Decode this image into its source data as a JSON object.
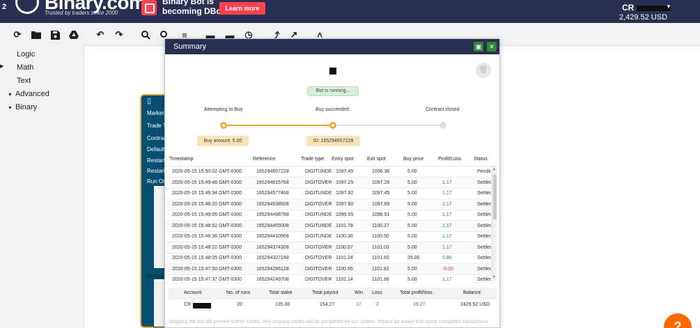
{
  "header": {
    "logo_text": "Binary.com",
    "tagline": "Trusted by traders since 2000",
    "promo_line1": "Binary Bot is",
    "promo_line2": "becoming DBot",
    "learn_more": "Learn more",
    "account_prefix": "CR",
    "balance": "2,429.52 USD"
  },
  "toolbar": {
    "icons": [
      "reset-icon",
      "open-folder-icon",
      "save-icon",
      "google-drive-icon",
      "undo-icon",
      "redo-icon",
      "zoom-in-icon",
      "zoom-out-icon",
      "rearrange-icon",
      "chart-icon",
      "tradingview-icon",
      "clock-icon",
      "run-icon",
      "stop-icon",
      "arrow-icon"
    ]
  },
  "sidebar": {
    "items": [
      {
        "label": "Logic",
        "caret": ""
      },
      {
        "label": "Math",
        "caret": ""
      },
      {
        "label": "Text",
        "caret": ""
      },
      {
        "label": "Advanced",
        "caret": "▼"
      },
      {
        "label": "Binary",
        "caret": "▼"
      }
    ]
  },
  "blocks": {
    "labels": [
      "Market",
      "Trade T",
      "Contrac",
      "Default",
      "Restart",
      "Restart",
      "Run On"
    ],
    "define_label": "Define"
  },
  "modal": {
    "title": "Summary",
    "status": "Bot is running...",
    "steps": [
      "Attempting to Buy",
      "Buy succeeded",
      "Contract closed"
    ],
    "buy_amount": "Buy amount: 5.00",
    "contract_id": "ID: 165294657228",
    "columns": [
      "Timestamp",
      "Reference",
      "Trade type",
      "Entry spot",
      "Exit spot",
      "Buy price",
      "Profit/Loss",
      "Status"
    ],
    "rows": [
      {
        "timestamp": "2020-05-15 15:50:02 GMT-0300",
        "reference": "165294657228",
        "type": "DIGITUNDE",
        "entry": "1097.45",
        "exit": "1096.36",
        "buy": "5.00",
        "pl": "",
        "pl_class": "",
        "status": "Pendin"
      },
      {
        "timestamp": "2020-05-15 15:49:48 GMT-0300",
        "reference": "165294615768",
        "type": "DIGITOVER",
        "entry": "1097.25",
        "exit": "1097.26",
        "buy": "5.00",
        "pl": "1.17",
        "pl_class": "pos",
        "status": "Settlec"
      },
      {
        "timestamp": "2020-05-15 15:49:34 GMT-0300",
        "reference": "165294577468",
        "type": "DIGITUNDE",
        "entry": "1097.92",
        "exit": "1097.45",
        "buy": "5.00",
        "pl": "1.17",
        "pl_class": "pos",
        "status": "Settlec"
      },
      {
        "timestamp": "2020-05-15 15:49:20 GMT-0300",
        "reference": "165294538508",
        "type": "DIGITOVER",
        "entry": "1097.60",
        "exit": "1097.69",
        "buy": "5.00",
        "pl": "1.17",
        "pl_class": "pos",
        "status": "Settlec"
      },
      {
        "timestamp": "2020-05-15 15:49:06 GMT-0300",
        "reference": "165294498788",
        "type": "DIGITUNDE",
        "entry": "1099.55",
        "exit": "1098.91",
        "buy": "5.00",
        "pl": "1.17",
        "pl_class": "pos",
        "status": "Settlec"
      },
      {
        "timestamp": "2020-05-15 15:48:52 GMT-0300",
        "reference": "165294455008",
        "type": "DIGITUNDE",
        "entry": "1101.78",
        "exit": "1100.27",
        "buy": "5.00",
        "pl": "1.17",
        "pl_class": "pos",
        "status": "Settlec"
      },
      {
        "timestamp": "2020-05-15 15:48:36 GMT-0300",
        "reference": "165294410908",
        "type": "DIGITUNDE",
        "entry": "1100.30",
        "exit": "1100.50",
        "buy": "5.00",
        "pl": "1.17",
        "pl_class": "pos",
        "status": "Settlec"
      },
      {
        "timestamp": "2020-05-15 15:48:22 GMT-0300",
        "reference": "165294374308",
        "type": "DIGITOVER",
        "entry": "1100.67",
        "exit": "1101.03",
        "buy": "5.00",
        "pl": "1.17",
        "pl_class": "pos",
        "status": "Settlec"
      },
      {
        "timestamp": "2020-05-15 15:48:05 GMT-0300",
        "reference": "165294327248",
        "type": "DIGITOVER",
        "entry": "1101.24",
        "exit": "1101.60",
        "buy": "25.00",
        "pl": "5.86",
        "pl_class": "pos",
        "status": "Settlec"
      },
      {
        "timestamp": "2020-05-15 15:47:50 GMT-0300",
        "reference": "165294286128",
        "type": "DIGITOVER",
        "entry": "1100.66",
        "exit": "1101.81",
        "buy": "5.00",
        "pl": "-5.00",
        "pl_class": "neg",
        "status": "Settlec"
      },
      {
        "timestamp": "2020-05-15 15:47:37 GMT-0300",
        "reference": "165294249708",
        "type": "DIGITOVER",
        "entry": "1102.14",
        "exit": "1101.86",
        "buy": "5.00",
        "pl": "1.17",
        "pl_class": "pos",
        "status": "Settlec"
      }
    ],
    "summary_columns": [
      "Account",
      "No. of runs",
      "Total stake",
      "Total payout",
      "Win",
      "Loss",
      "Total profit/loss",
      "Balance"
    ],
    "summary": {
      "account_prefix": "CR",
      "runs": "20",
      "stake": "135.00",
      "payout": "154.27",
      "win": "17",
      "loss": "2",
      "profit": "19.27",
      "balance": "2429.52 USD"
    },
    "note": "Stopping the bot will prevent further trades. Any ongoing trades will be completed by our system. Please be aware that some completed transactions may not be displayed in the table if the bot is stopped while placing trades. You may refer to the statement page for details of all completed transactions."
  },
  "colors": {
    "header_bg": "#2a3052",
    "accent_orange": "#f2a93b",
    "brand_red": "#ff444f",
    "profit_green": "#2a8f3a",
    "loss_red": "#e31c4b",
    "help_orange": "#ff6a00"
  }
}
